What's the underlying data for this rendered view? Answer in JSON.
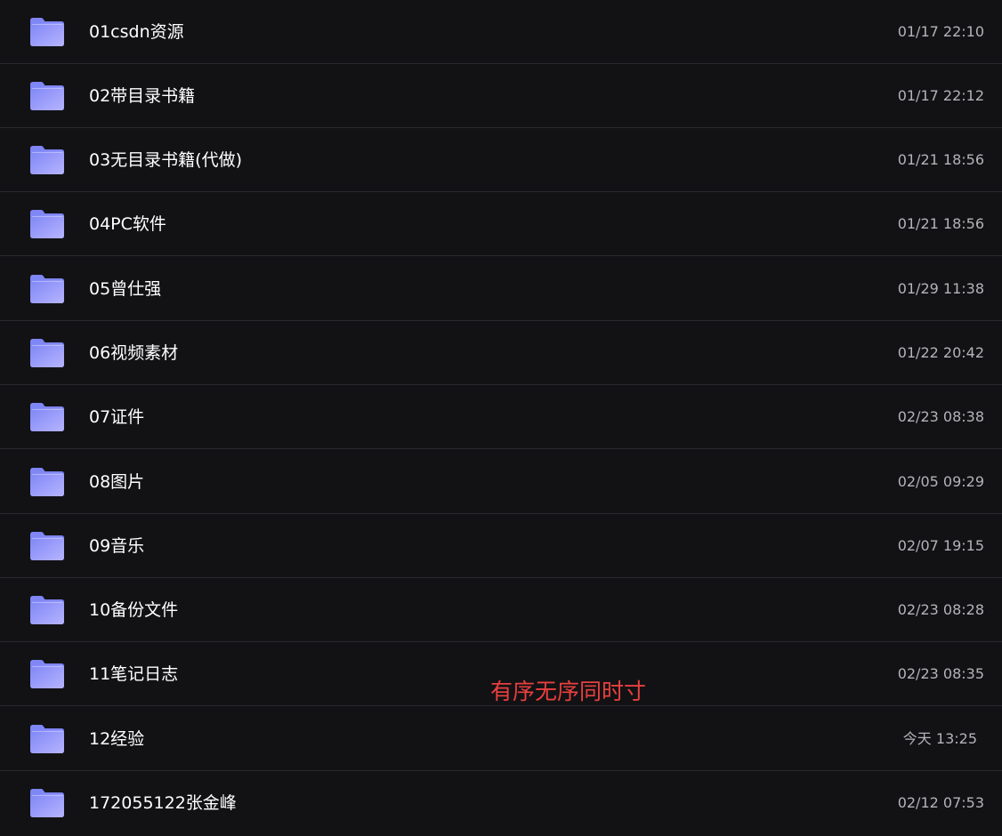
{
  "files": [
    {
      "name": "01csdn资源",
      "modified": "01/17 22:10",
      "icon": "folder-icon"
    },
    {
      "name": "02带目录书籍",
      "modified": "01/17 22:12",
      "icon": "folder-icon"
    },
    {
      "name": "03无目录书籍(代做)",
      "modified": "01/21 18:56",
      "icon": "folder-icon"
    },
    {
      "name": "04PC软件",
      "modified": "01/21 18:56",
      "icon": "folder-icon"
    },
    {
      "name": "05曾仕强",
      "modified": "01/29 11:38",
      "icon": "folder-icon"
    },
    {
      "name": "06视频素材",
      "modified": "01/22 20:42",
      "icon": "folder-icon"
    },
    {
      "name": "07证件",
      "modified": "02/23 08:38",
      "icon": "folder-icon"
    },
    {
      "name": "08图片",
      "modified": "02/05 09:29",
      "icon": "folder-icon"
    },
    {
      "name": "09音乐",
      "modified": "02/07 19:15",
      "icon": "folder-icon"
    },
    {
      "name": "10备份文件",
      "modified": "02/23 08:28",
      "icon": "folder-icon"
    },
    {
      "name": "11笔记日志",
      "modified": "02/23 08:35",
      "icon": "folder-icon"
    },
    {
      "name": "12经验",
      "modified": "今天 13:25",
      "icon": "folder-icon"
    },
    {
      "name": "172055122张金峰",
      "modified": "02/12 07:53",
      "icon": "folder-icon"
    }
  ],
  "overlay_note": "有序无序同时寸",
  "colors": {
    "background": "#121215",
    "divider": "#2a2a2e",
    "name_text": "#ffffff",
    "time_text": "#b4b4b8",
    "folder_light": "#b6b4ff",
    "folder_dark": "#7f86f5",
    "note_text": "#e8403e"
  }
}
